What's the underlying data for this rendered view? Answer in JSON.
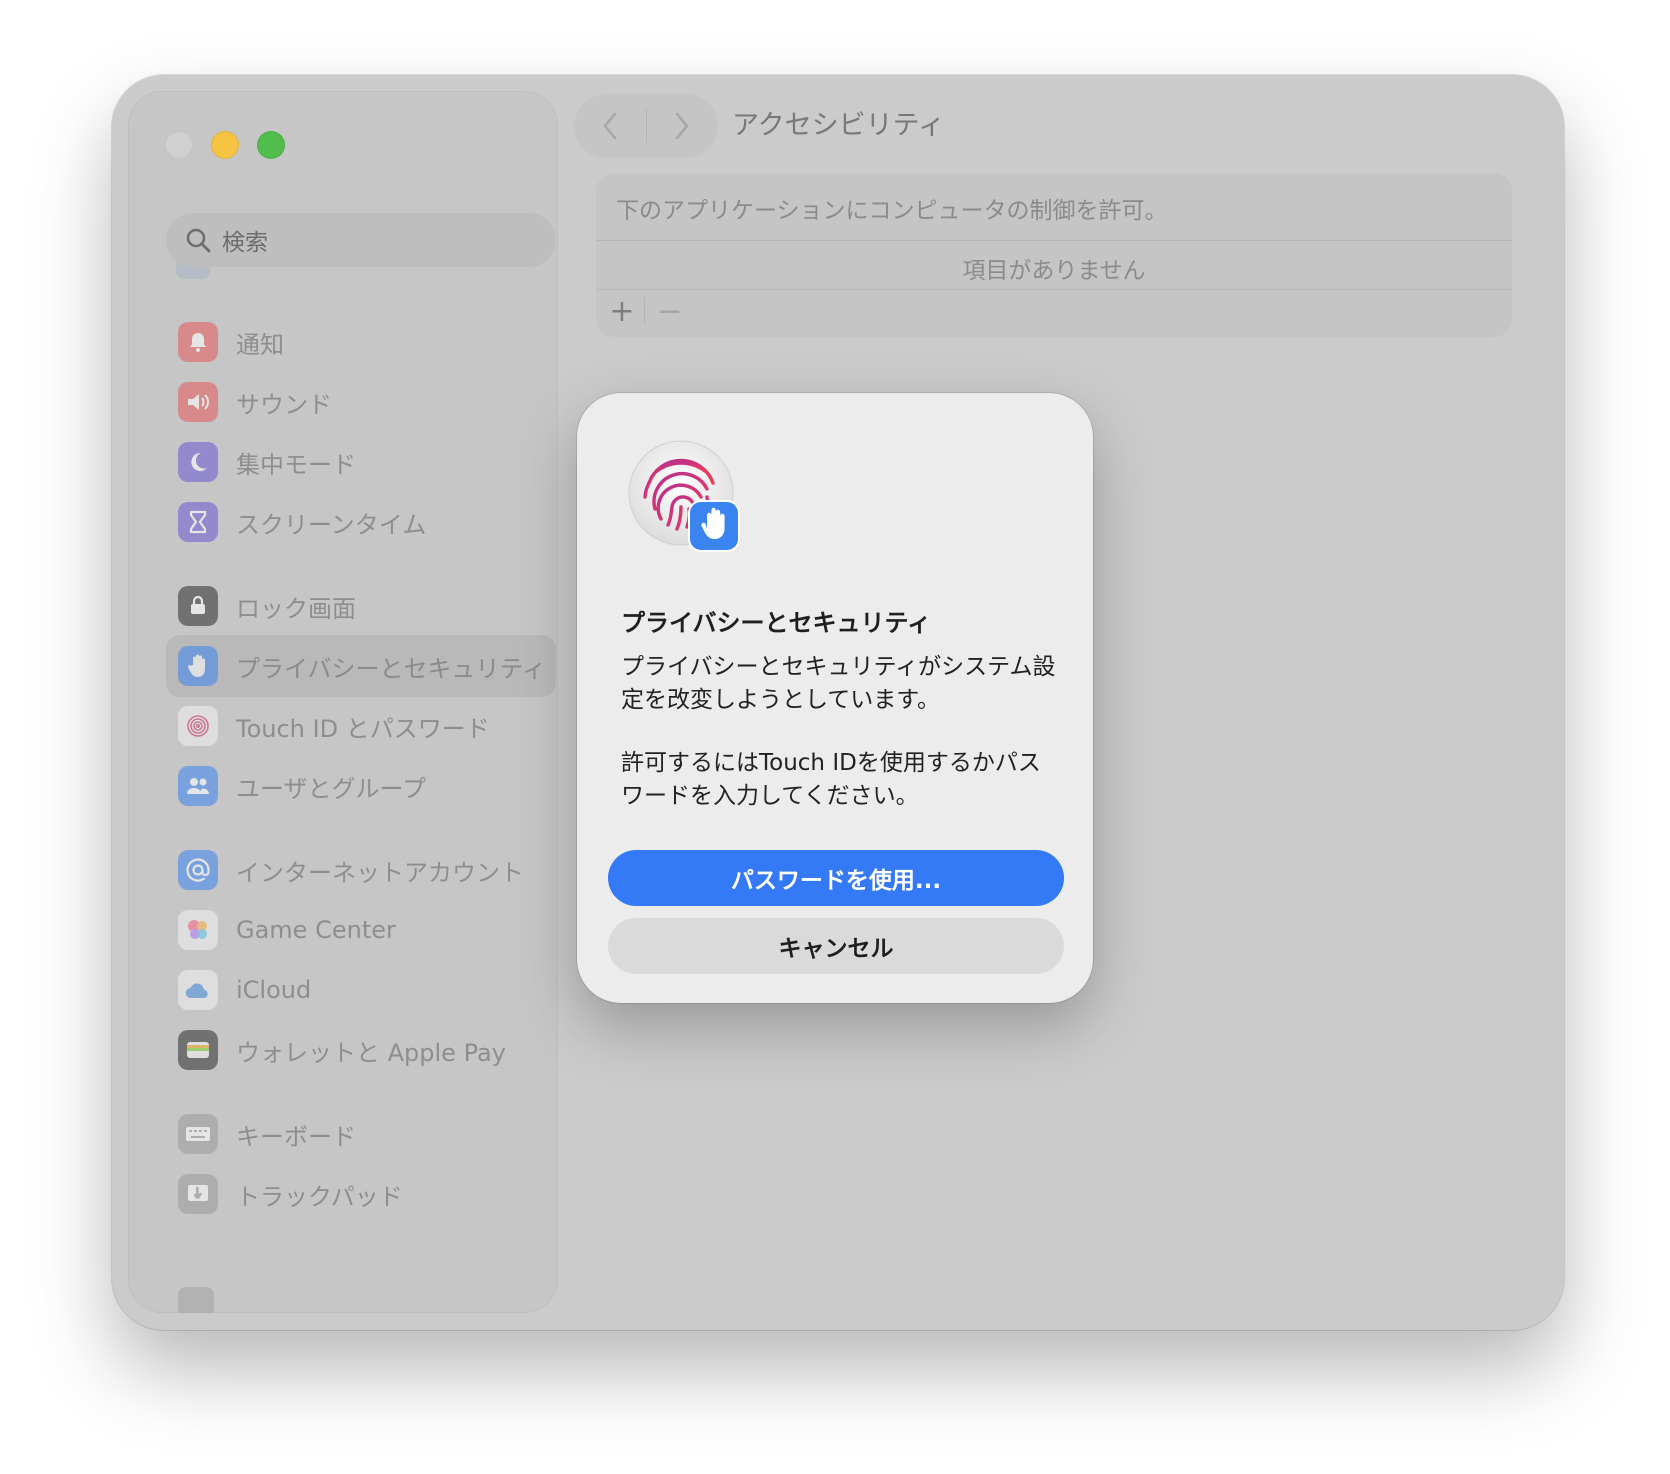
{
  "window": {
    "title": "アクセシビリティ"
  },
  "search": {
    "placeholder": "検索"
  },
  "sidebar": {
    "items": [
      {
        "label": "通知",
        "icon": "bell-icon",
        "color": "#e8595a"
      },
      {
        "label": "サウンド",
        "icon": "speaker-icon",
        "color": "#e8595a"
      },
      {
        "label": "集中モード",
        "icon": "moon-icon",
        "color": "#6a5ad6"
      },
      {
        "label": "スクリーンタイム",
        "icon": "hourglass-icon",
        "color": "#6a5ad6"
      },
      {
        "label": "ロック画面",
        "icon": "lock-icon",
        "color": "#2c2c2c"
      },
      {
        "label": "プライバシーとセキュリティ",
        "icon": "hand-icon",
        "color": "#3a84f0",
        "selected": true
      },
      {
        "label": "Touch ID とパスワード",
        "icon": "fingerprint-icon",
        "color": "#ffffff"
      },
      {
        "label": "ユーザとグループ",
        "icon": "users-icon",
        "color": "#3a84f0"
      },
      {
        "label": "インターネットアカウント",
        "icon": "at-icon",
        "color": "#3a84f0"
      },
      {
        "label": "Game Center",
        "icon": "game-center-icon",
        "color": "#ffffff"
      },
      {
        "label": "iCloud",
        "icon": "cloud-icon",
        "color": "#ffffff"
      },
      {
        "label": "ウォレットと Apple Pay",
        "icon": "wallet-icon",
        "color": "#2c2c2c"
      },
      {
        "label": "キーボード",
        "icon": "keyboard-icon",
        "color": "#8a8a8a"
      },
      {
        "label": "トラックパッド",
        "icon": "trackpad-icon",
        "color": "#8a8a8a"
      }
    ]
  },
  "content": {
    "description": "下のアプリケーションにコンピュータの制御を許可。",
    "empty_text": "項目がありません",
    "add_label": "+",
    "remove_label": "−"
  },
  "dialog": {
    "title": "プライバシーとセキュリティ",
    "message1": "プライバシーとセキュリティがシステム設定を改変しようとしています。",
    "message2": "許可するにはTouch IDを使用するかパスワードを入力してください。",
    "primary_button": "パスワードを使用...",
    "cancel_button": "キャンセル",
    "accent_color": "#3479f6"
  }
}
